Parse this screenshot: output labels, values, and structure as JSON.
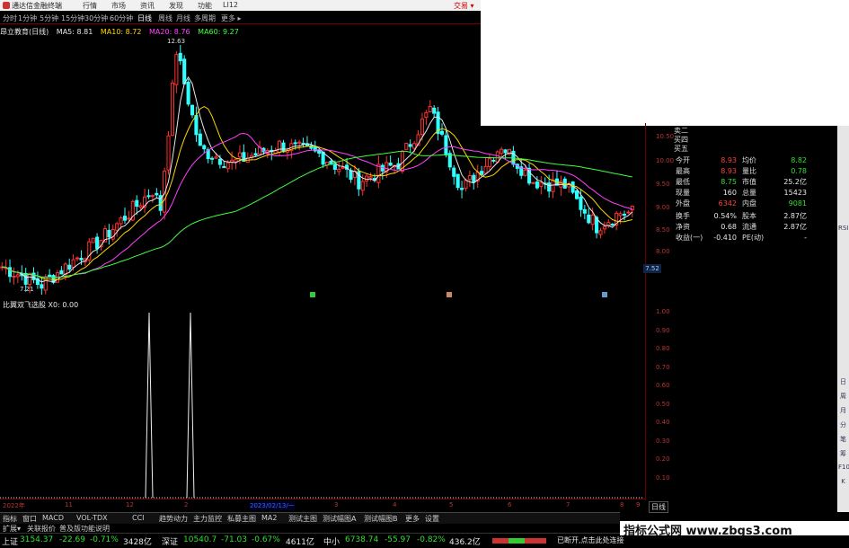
{
  "app": {
    "title": "通达信金融终端",
    "menu": [
      "行情",
      "市场",
      "资讯",
      "发现",
      "功能",
      "LI12"
    ],
    "trade": "交易 ▾"
  },
  "periods": [
    "分时",
    "1分钟",
    "5分钟",
    "15分钟",
    "30分钟",
    "60分钟",
    "日线",
    "周线",
    "月线",
    "多周期",
    "更多 ▸"
  ],
  "active_period": "日线",
  "legend": {
    "name": "昂立教育(日线)",
    "ma5": "MA5: 8.81",
    "ma10": "MA10: 8.72",
    "ma20": "MA20: 8.76",
    "ma60": "MA60: 9.27",
    "colors": {
      "ma5": "#e8e8e8",
      "ma10": "#ffd700",
      "ma20": "#ff40ff",
      "ma60": "#40ff40"
    }
  },
  "chart_data": [
    {
      "type": "candlestick",
      "title": "昂立教育(日线)",
      "ylim": [
        7.2,
        12.7
      ],
      "yticks": [
        "10.50",
        "10.00",
        "9.50",
        "9.00",
        "8.50",
        "8.00"
      ],
      "annotations": [
        {
          "label": "12.63"
        },
        {
          "label": "7.21"
        }
      ],
      "current_price": "7.52",
      "series": [
        {
          "name": "MA5",
          "color": "#e8e8e8"
        },
        {
          "name": "MA10",
          "color": "#ffd700"
        },
        {
          "name": "MA20",
          "color": "#ff40ff"
        },
        {
          "name": "MA60",
          "color": "#40ff40"
        }
      ]
    },
    {
      "type": "line",
      "title": "比翼双飞选股",
      "value_label": "X0: 0.00",
      "ylim": [
        0,
        1.0
      ],
      "yticks": [
        "1.00",
        "0.90",
        "0.80",
        "0.70",
        "0.60",
        "0.50",
        "0.40",
        "0.30",
        "0.20",
        "0.10"
      ],
      "signals": [
        1,
        1
      ]
    }
  ],
  "quote": {
    "header": [
      "卖二",
      "买四",
      "买五"
    ],
    "rows": [
      {
        "k": "今开",
        "v": "8.93",
        "k2": "均价",
        "v2": "8.82"
      },
      {
        "k": "最高",
        "v": "8.93",
        "k2": "量比",
        "v2": "0.78"
      },
      {
        "k": "最低",
        "v": "8.75",
        "k2": "市值",
        "v2": "25.2亿"
      },
      {
        "k": "现量",
        "v": "160",
        "k2": "总量",
        "v2": "15423"
      },
      {
        "k": "外盘",
        "v": "6342",
        "k2": "内盘",
        "v2": "9081"
      },
      {
        "k": "换手",
        "v": "0.54%",
        "k2": "股本",
        "v2": "2.87亿"
      },
      {
        "k": "净资",
        "v": "0.68",
        "k2": "流通",
        "v2": "2.87亿"
      },
      {
        "k": "收益(一)",
        "v": "-0.410",
        "k2": "PE(动)",
        "v2": "-"
      }
    ]
  },
  "indicator": {
    "name": "比翼双飞选股",
    "value": "X0: 0.00"
  },
  "xaxis": {
    "labels": [
      "2022年",
      "11",
      "12",
      "2",
      "3",
      "4",
      "5",
      "6",
      "7",
      "8",
      "9"
    ],
    "cursor_date": "2023/02/13/一",
    "day_button": "日线"
  },
  "tabs": [
    "指标",
    "窗口",
    "MACD",
    "VOL-TDX",
    "CCI",
    "趋势动力",
    "主力监控",
    "私募主图",
    "MA2",
    "测试主图",
    "测试幅图A",
    "测试幅图B",
    "更多",
    "设置"
  ],
  "subtabs": [
    "扩展▾",
    "关联报价",
    "普及版功能说明"
  ],
  "sidebar": [
    "日",
    "周",
    "月",
    "分",
    "笔",
    "筹",
    "F10",
    "K",
    "RSI"
  ],
  "status": {
    "sh": {
      "name": "上证",
      "value": "3154.37",
      "chg": "-22.69",
      "pct": "-0.71%",
      "amt": "3428亿"
    },
    "sz": {
      "name": "深证",
      "value": "10540.7",
      "chg": "-71.03",
      "pct": "-0.67%",
      "amt": "4611亿"
    },
    "zx": {
      "name": "中小",
      "value": "6738.74",
      "chg": "-55.97",
      "pct": "-0.82%",
      "amt": "436.2亿"
    },
    "hint": "已断开,点击此处连接"
  },
  "watermark": "指标公式网 www.zbgs3.com"
}
